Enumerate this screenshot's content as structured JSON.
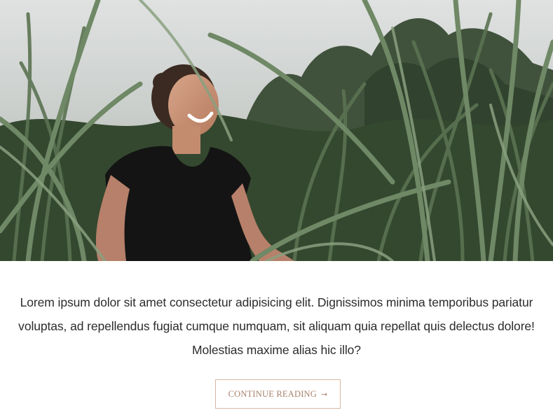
{
  "hero": {
    "image_description_icon": "photo-woman-in-tall-grass"
  },
  "post": {
    "excerpt_line_1": "Lorem ipsum dolor sit amet consectetur adipisicing elit. Dignissimos minima temporibus pariatur",
    "excerpt_line_2": "voluptas, ad repellendus fugiat cumque numquam, sit aliquam quia repellat quis delectus dolore!",
    "excerpt_line_3": "Molestias maxime alias hic illo?",
    "continue_label": "CONTINUE READING",
    "continue_icon": "arrow-right-icon",
    "continue_arrow": "→"
  },
  "colors": {
    "button_border": "#d7b6a3",
    "button_text": "#a8836d",
    "body_text": "#2c2c2c"
  }
}
